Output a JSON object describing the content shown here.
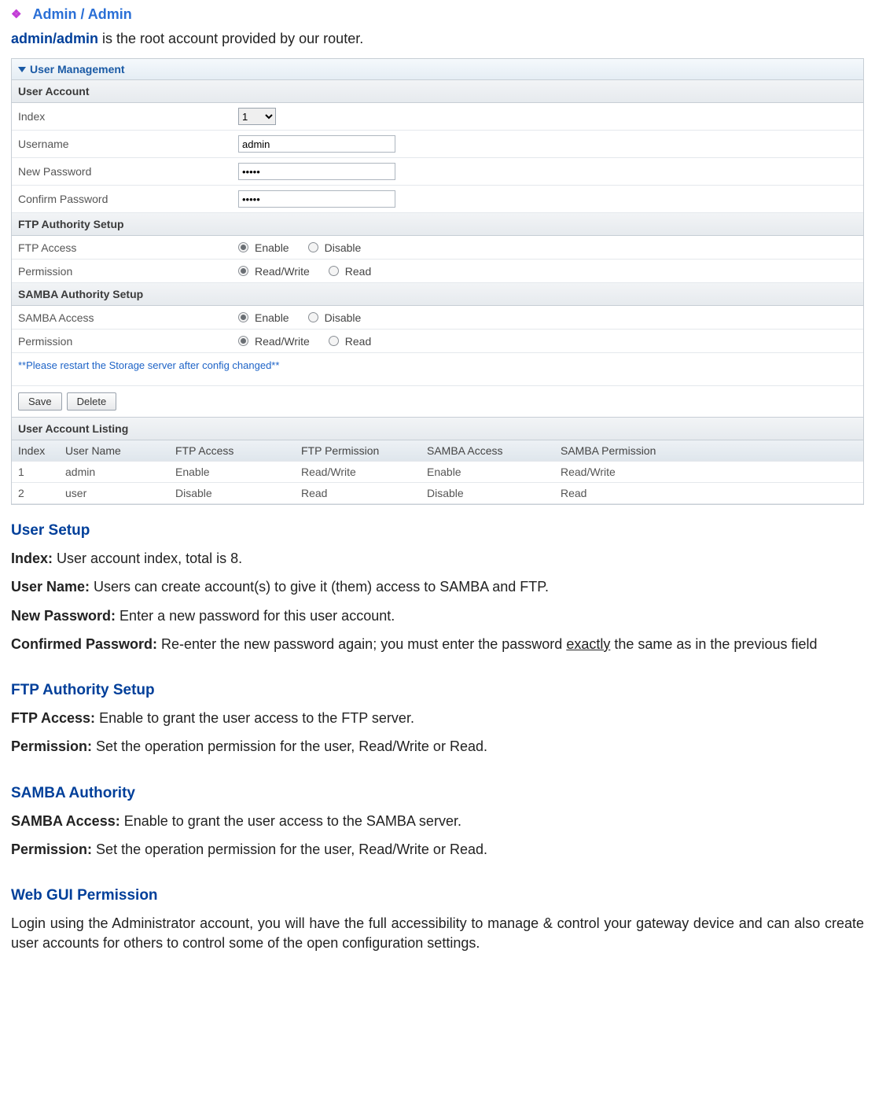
{
  "top_heading": "Admin / Admin",
  "intro": {
    "bold": "admin/admin",
    "rest": " is the root account provided by our router."
  },
  "panel": {
    "section_title": "User Management",
    "user_account": {
      "title": "User Account",
      "index_label": "Index",
      "index_value": "1",
      "username_label": "Username",
      "username_value": "admin",
      "newpwd_label": "New Password",
      "newpwd_value": "•••••",
      "confpwd_label": "Confirm Password",
      "confpwd_value": "•••••"
    },
    "ftp": {
      "title": "FTP Authority Setup",
      "access_label": "FTP Access",
      "perm_label": "Permission",
      "opt_enable": "Enable",
      "opt_disable": "Disable",
      "opt_rw": "Read/Write",
      "opt_r": "Read"
    },
    "samba": {
      "title": "SAMBA Authority Setup",
      "access_label": "SAMBA Access",
      "perm_label": "Permission",
      "opt_enable": "Enable",
      "opt_disable": "Disable",
      "opt_rw": "Read/Write",
      "opt_r": "Read"
    },
    "restart_note": "**Please restart the Storage server after config changed**",
    "buttons": {
      "save": "Save",
      "delete": "Delete"
    },
    "listing": {
      "title": "User Account Listing",
      "headers": {
        "index": "Index",
        "user": "User Name",
        "ftp_access": "FTP Access",
        "ftp_perm": "FTP Permission",
        "samba_access": "SAMBA Access",
        "samba_perm": "SAMBA Permission"
      },
      "rows": [
        {
          "index": "1",
          "user": "admin",
          "ftp_access": "Enable",
          "ftp_perm": "Read/Write",
          "samba_access": "Enable",
          "samba_perm": "Read/Write"
        },
        {
          "index": "2",
          "user": "user",
          "ftp_access": "Disable",
          "ftp_perm": "Read",
          "samba_access": "Disable",
          "samba_perm": "Read"
        }
      ]
    }
  },
  "doc": {
    "user_setup": {
      "heading": "User Setup",
      "index_l": "Index:",
      "index_t": " User account index, total is 8.",
      "uname_l": "User Name:",
      "uname_t": " Users can create account(s) to give it (them) access to SAMBA and FTP.",
      "npwd_l": "New Password:",
      "npwd_t": " Enter a new password for this user account.",
      "cpwd_l": "Confirmed Password:",
      "cpwd_t1": " Re-enter the new password again; you must enter the password ",
      "cpwd_u": "exactly",
      "cpwd_t2": " the same as in the previous field"
    },
    "ftp_auth": {
      "heading": "FTP Authority Setup",
      "access_l": "FTP Access:",
      "access_t": " Enable to grant the user access to the FTP server.",
      "perm_l": "Permission:",
      "perm_t": " Set the operation permission for the user, Read/Write or Read."
    },
    "samba_auth": {
      "heading": "SAMBA Authority",
      "access_l": "SAMBA Access:",
      "access_t": " Enable to grant the user access to the SAMBA server.",
      "perm_l": "Permission:",
      "perm_t": " Set the operation permission for the user, Read/Write or Read."
    },
    "webgui": {
      "heading": "Web GUI Permission",
      "text": "Login using the Administrator account, you will have the full accessibility to manage & control your gateway device and can also create user accounts for others to control some of the open configuration settings."
    }
  }
}
